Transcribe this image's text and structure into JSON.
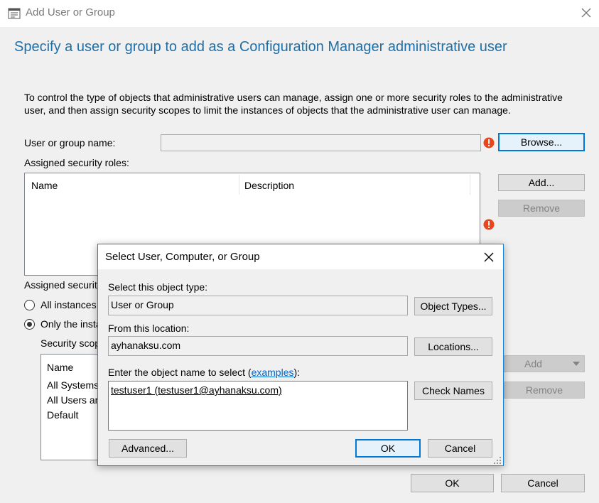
{
  "window": {
    "title": "Add User or Group",
    "heading": "Specify a user or group to add as a Configuration Manager administrative user",
    "instructions": "To control the type of objects that administrative users can manage, assign one or more security roles  to the  administrative user, and then assign security scopes to limit the instances of objects that the administrative user can manage."
  },
  "user_group": {
    "label": "User or group name:",
    "value": "",
    "browse_label": "Browse..."
  },
  "roles": {
    "label": "Assigned security roles:",
    "columns": [
      "Name",
      "Description"
    ],
    "add_label": "Add...",
    "remove_label": "Remove"
  },
  "scopes": {
    "label": "Assigned security",
    "option_all": "All instances",
    "option_only": "Only the insta",
    "security_scopes_label": "Security scop",
    "list_header": "Name",
    "items": [
      "All Systems",
      "All Users an",
      "Default"
    ],
    "add_label": "Add",
    "remove_label": "Remove"
  },
  "footer": {
    "ok_label": "OK",
    "cancel_label": "Cancel"
  },
  "select_dialog": {
    "title": "Select User, Computer, or Group",
    "object_type_label": "Select this object type:",
    "object_type_value": "User or Group",
    "object_types_button": "Object Types...",
    "location_label": "From this location:",
    "location_value": "ayhanaksu.com",
    "locations_button": "Locations...",
    "enter_label_prefix": "Enter the object name to select (",
    "enter_label_link": "examples",
    "enter_label_suffix": "):",
    "object_name_value": "testuser1 (testuser1@ayhanaksu.com)",
    "check_names_button": "Check Names",
    "advanced_button": "Advanced...",
    "ok_label": "OK",
    "cancel_label": "Cancel"
  },
  "colors": {
    "heading": "#1e6fa8",
    "error_icon": "#e8461d",
    "dialog_border": "#1883d7",
    "default_button_border": "#0078d7"
  }
}
